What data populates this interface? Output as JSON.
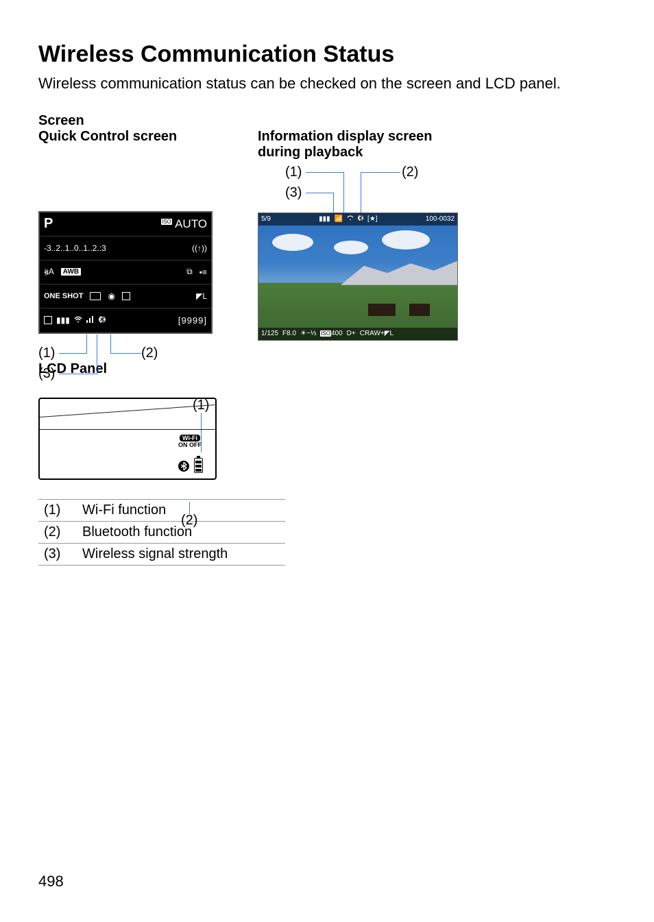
{
  "title": "Wireless Communication Status",
  "intro": "Wireless communication status can be checked on the screen and LCD panel.",
  "screen_label": "Screen",
  "qc_label": "Quick Control screen",
  "info_label": "Information display screen during playback",
  "lcd_label": "LCD Panel",
  "callouts": {
    "one": "(1)",
    "two": "(2)",
    "three": "(3)"
  },
  "qc": {
    "mode": "P",
    "iso_prefix": "ISO",
    "iso_value": "AUTO",
    "ev_scale": "-3..2..1..0..1..2.:3",
    "remote": "((↑))",
    "awb": "AWB",
    "picstyle": "⦖A",
    "oneshot": "ONE SHOT",
    "quality": "◤L",
    "shots": "[9999]",
    "q_icon": "Q",
    "wifi": "•",
    "signal": "▉▉▊",
    "bt": "฿"
  },
  "info": {
    "index": "5/9",
    "folder": "100-0032",
    "shutter": "1/125",
    "aperture": "F8.0",
    "expo_comp": "−⅓",
    "iso_prefix": "ISO",
    "iso": "400",
    "dplus": "D+",
    "quality": "CRAW+◤L"
  },
  "lcd": {
    "wifi_label": "Wi-Fi",
    "wifi_onoff": "ON OFF"
  },
  "legend": [
    {
      "n": "(1)",
      "t": "Wi-Fi function"
    },
    {
      "n": "(2)",
      "t": "Bluetooth function"
    },
    {
      "n": "(3)",
      "t": "Wireless signal strength"
    }
  ],
  "page_number": "498"
}
